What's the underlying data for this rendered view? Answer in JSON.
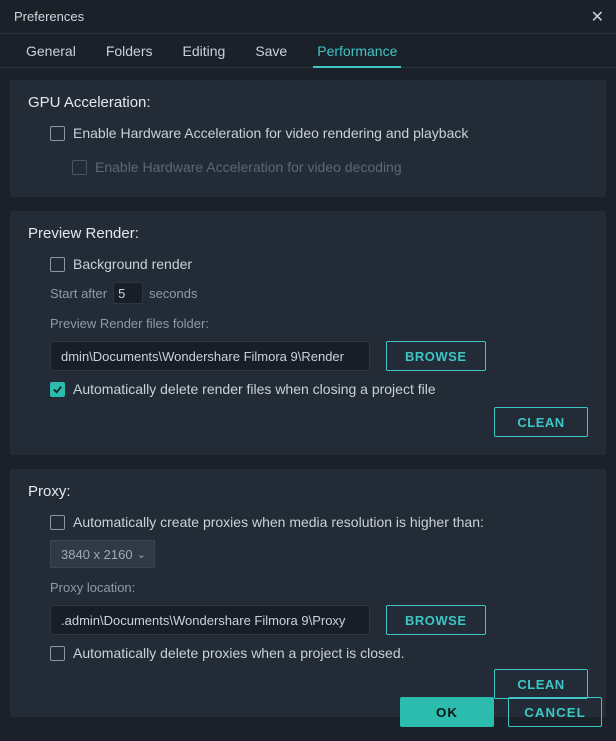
{
  "window": {
    "title": "Preferences"
  },
  "tabs": {
    "general": "General",
    "folders": "Folders",
    "editing": "Editing",
    "save": "Save",
    "performance": "Performance"
  },
  "gpu": {
    "title": "GPU Acceleration:",
    "enable_render": "Enable Hardware Acceleration for video rendering and playback",
    "enable_decode": "Enable Hardware Acceleration for video decoding"
  },
  "preview": {
    "title": "Preview Render:",
    "background_render": "Background render",
    "start_after": "Start after",
    "start_after_value": "5",
    "seconds": "seconds",
    "folder_label": "Preview Render files folder:",
    "folder_path": "dmin\\Documents\\Wondershare Filmora 9\\Render",
    "browse": "BROWSE",
    "auto_delete": "Automatically delete render files when closing a project file",
    "clean": "CLEAN"
  },
  "proxy": {
    "title": "Proxy:",
    "auto_create": "Automatically create proxies when media resolution is higher than:",
    "resolution": "3840 x 2160",
    "location_label": "Proxy location:",
    "location_path": ".admin\\Documents\\Wondershare Filmora 9\\Proxy",
    "browse": "BROWSE",
    "auto_delete": "Automatically delete proxies when a project is closed.",
    "clean": "CLEAN"
  },
  "footer": {
    "ok": "OK",
    "cancel": "CANCEL"
  }
}
